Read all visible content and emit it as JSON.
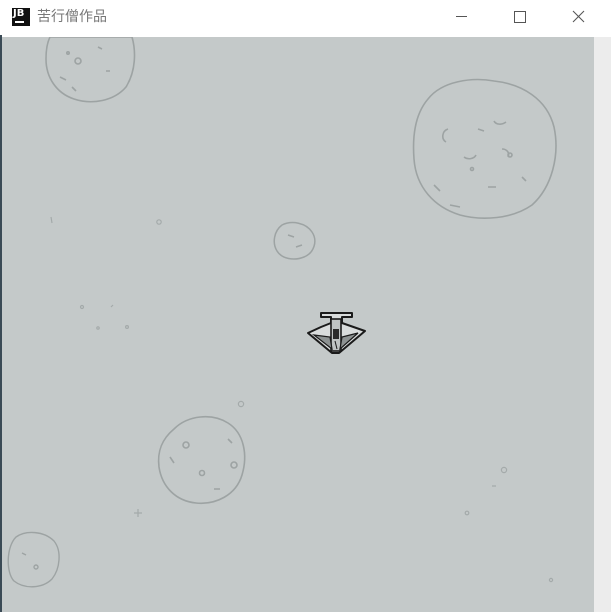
{
  "window": {
    "title": "苦行僧作品",
    "app_icon_text": "JB",
    "controls": [
      "minimize",
      "maximize",
      "close"
    ]
  },
  "game": {
    "background_color": "#c4c9c9",
    "sprites": [
      "asteroid",
      "asteroid",
      "asteroid",
      "asteroid",
      "asteroid",
      "player-ship"
    ]
  }
}
